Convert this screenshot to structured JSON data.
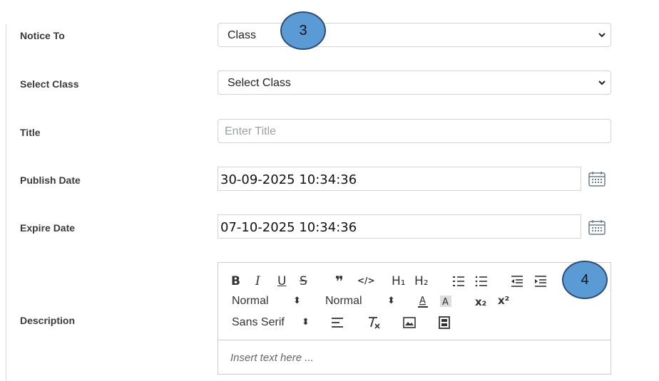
{
  "form": {
    "notice_to": {
      "label": "Notice To",
      "value": "Class"
    },
    "select_class": {
      "label": "Select Class",
      "value": "Select Class"
    },
    "title": {
      "label": "Title",
      "placeholder": "Enter Title"
    },
    "publish_date": {
      "label": "Publish Date",
      "value": "30-09-2025 10:34:36"
    },
    "expire_date": {
      "label": "Expire Date",
      "value": "07-10-2025 10:34:36"
    },
    "description": {
      "label": "Description",
      "placeholder": "Insert text here ...",
      "toolbar": {
        "bold": "B",
        "italic": "I",
        "underline": "U",
        "strike": "S",
        "blockquote": "❞",
        "code": "</>",
        "h1": "H₁",
        "h2": "H₂",
        "header_select": "Normal",
        "size_select": "Normal",
        "font_select": "Sans Serif",
        "subscript": "x₂",
        "superscript": "x²"
      }
    }
  },
  "callouts": {
    "first": "3",
    "second": "4"
  },
  "colors": {
    "callout_fill": "#5b9bd5",
    "callout_border": "#2e4e76",
    "border": "#ced4da"
  },
  "icons": [
    "chevron-down-icon",
    "calendar-icon",
    "text-color-icon",
    "highlight-icon",
    "align-icon",
    "clear-format-icon",
    "image-icon",
    "video-icon",
    "ordered-list-icon",
    "bullet-list-icon",
    "outdent-icon",
    "indent-icon"
  ]
}
